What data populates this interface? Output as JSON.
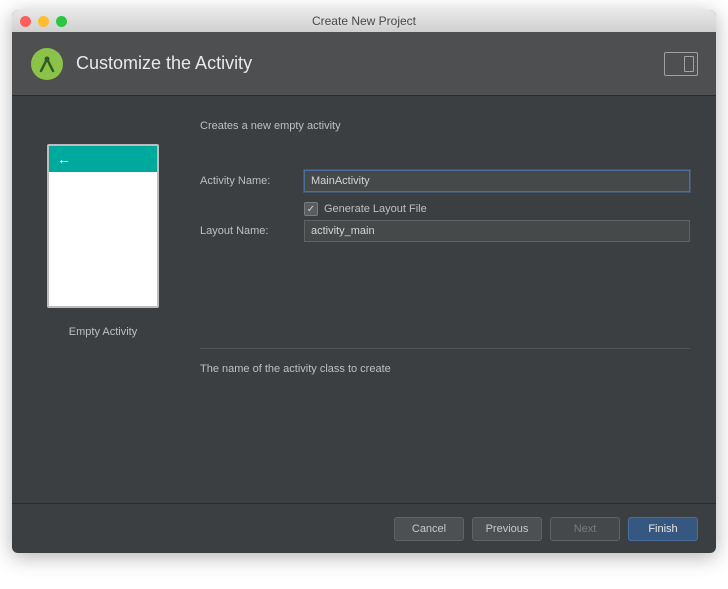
{
  "window": {
    "title": "Create New Project"
  },
  "header": {
    "title": "Customize the Activity"
  },
  "preview": {
    "label": "Empty Activity"
  },
  "form": {
    "description": "Creates a new empty activity",
    "activity_name_label": "Activity Name:",
    "activity_name_value": "MainActivity",
    "generate_layout_label": "Generate Layout File",
    "generate_layout_checked": true,
    "layout_name_label": "Layout Name:",
    "layout_name_value": "activity_main",
    "help_text": "The name of the activity class to create"
  },
  "footer": {
    "cancel": "Cancel",
    "previous": "Previous",
    "next": "Next",
    "finish": "Finish"
  }
}
